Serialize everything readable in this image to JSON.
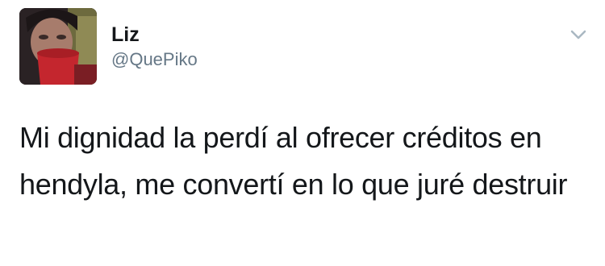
{
  "tweet": {
    "author": {
      "display_name": "Liz",
      "handle": "@QuePiko"
    },
    "text": "Mi dignidad la perdí al ofrecer créditos en hendyla, me convertí en lo que juré destruir",
    "menu_icon": "chevron-down-icon"
  }
}
